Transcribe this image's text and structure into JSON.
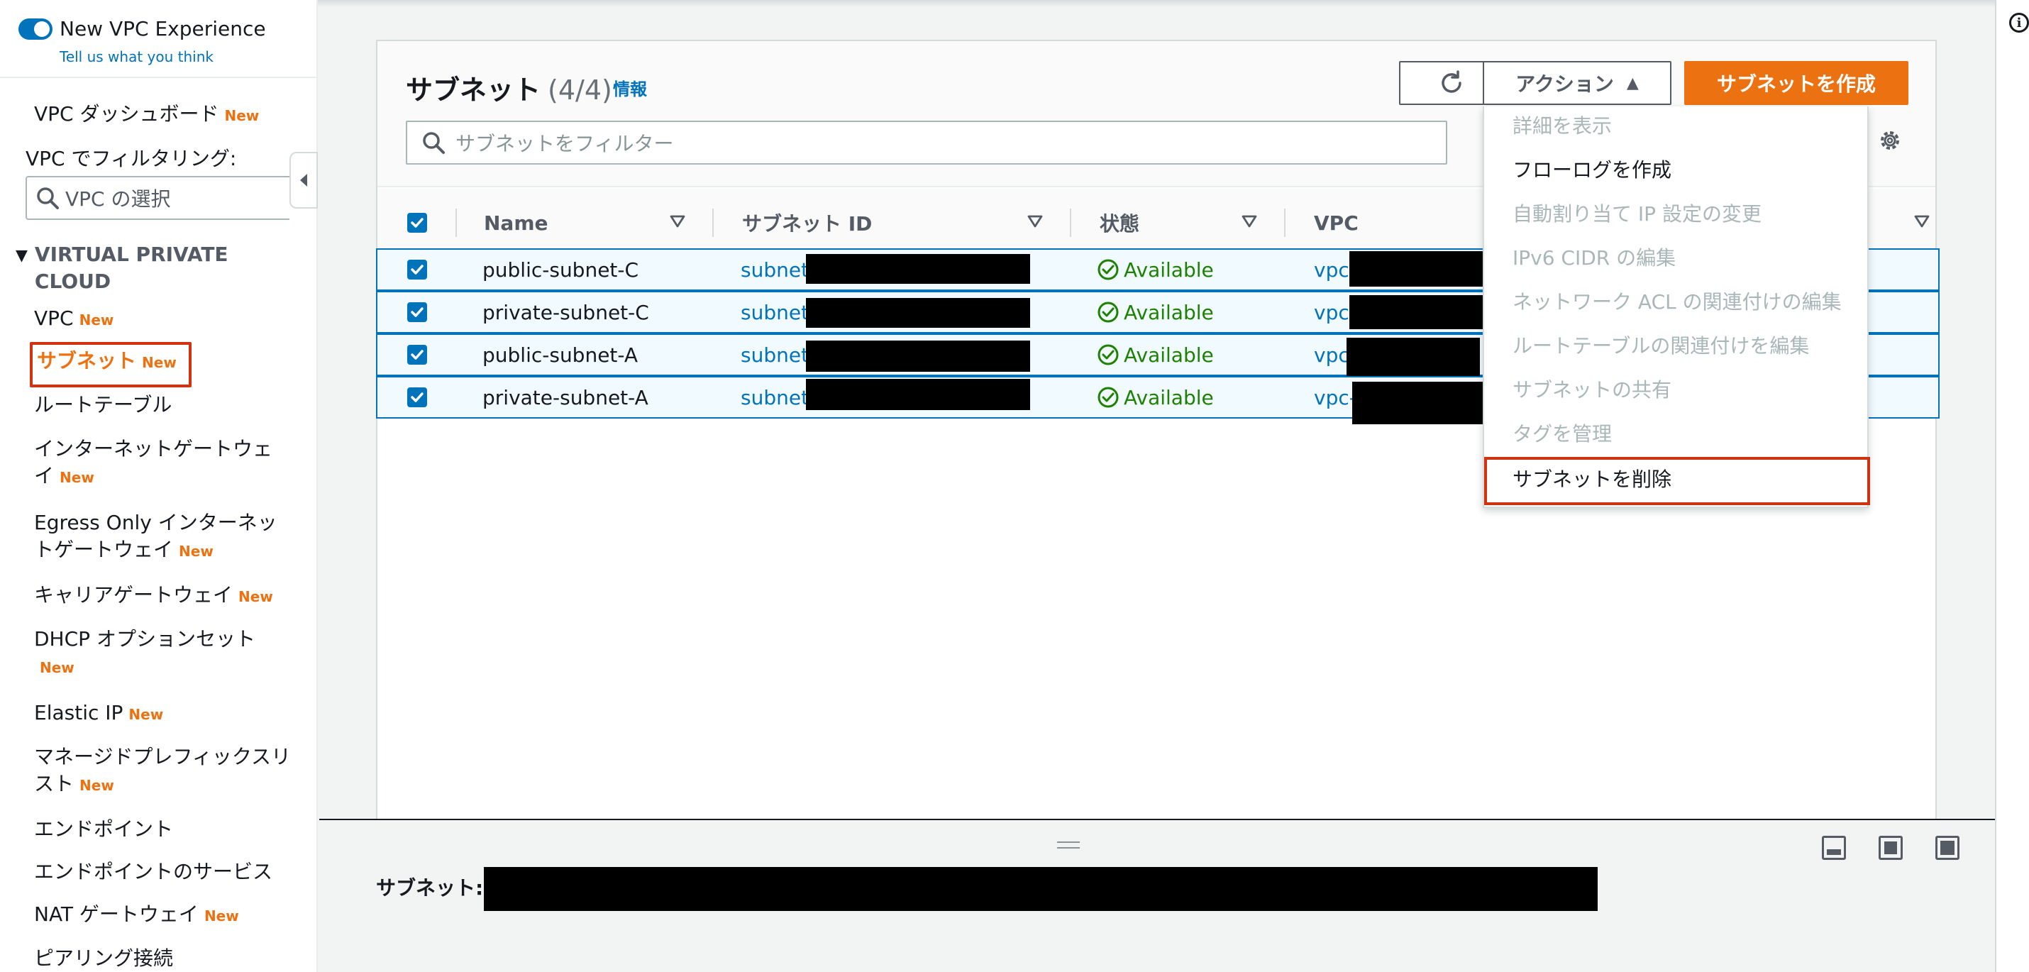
{
  "sidebar": {
    "toggle_label": "New VPC Experience",
    "feedback_link": "Tell us what you think",
    "dashboard": {
      "label": "VPC ダッシュボード",
      "badge": "New"
    },
    "filter_label": "VPC でフィルタリング:",
    "vpc_select_placeholder": "VPC の選択",
    "section_title": "VIRTUAL PRIVATE CLOUD",
    "items": [
      {
        "label": "VPC",
        "badge": "New"
      },
      {
        "label": "サブネット",
        "badge": "New",
        "active": true
      },
      {
        "label": "ルートテーブル",
        "badge": ""
      },
      {
        "label": "インターネットゲートウェイ",
        "badge": "New"
      },
      {
        "label": "Egress Only インターネットゲートウェイ",
        "badge": "New"
      },
      {
        "label": "キャリアゲートウェイ",
        "badge": "New"
      },
      {
        "label": "DHCP オプションセット",
        "badge": "New"
      },
      {
        "label": "Elastic IP",
        "badge": "New"
      },
      {
        "label": "マネージドプレフィックスリスト",
        "badge": "New"
      },
      {
        "label": "エンドポイント",
        "badge": ""
      },
      {
        "label": "エンドポイントのサービス",
        "badge": ""
      },
      {
        "label": "NAT ゲートウェイ",
        "badge": "New"
      },
      {
        "label": "ピアリング接続",
        "badge": ""
      }
    ]
  },
  "panel": {
    "title": "サブネット",
    "count": "(4/4)",
    "info_link": "情報",
    "actions_label": "アクション",
    "create_label": "サブネットを作成",
    "search_placeholder": "サブネットをフィルター"
  },
  "table": {
    "columns": [
      "Name",
      "サブネット ID",
      "状態",
      "VPC"
    ],
    "rows": [
      {
        "name": "public-subnet-C",
        "subnet_id": "subnet-",
        "status": "Available",
        "vpc": "vpc-",
        "checked": true
      },
      {
        "name": "private-subnet-C",
        "subnet_id": "subnet-",
        "status": "Available",
        "vpc": "vpc-",
        "checked": true
      },
      {
        "name": "public-subnet-A",
        "subnet_id": "subnet-",
        "status": "Available",
        "vpc": "vpc-",
        "checked": true
      },
      {
        "name": "private-subnet-A",
        "subnet_id": "subnet-",
        "status": "Available",
        "vpc": "vpc-",
        "checked": true
      }
    ]
  },
  "actions_menu": {
    "items": [
      {
        "label": "詳細を表示",
        "enabled": false
      },
      {
        "label": "フローログを作成",
        "enabled": true
      },
      {
        "label": "自動割り当て IP 設定の変更",
        "enabled": false
      },
      {
        "label": "IPv6 CIDR の編集",
        "enabled": false
      },
      {
        "label": "ネットワーク ACL の関連付けの編集",
        "enabled": false
      },
      {
        "label": "ルートテーブルの関連付けを編集",
        "enabled": false
      },
      {
        "label": "サブネットの共有",
        "enabled": false
      },
      {
        "label": "タグを管理",
        "enabled": false
      },
      {
        "label": "サブネットを削除",
        "enabled": true,
        "highlighted": true
      }
    ]
  },
  "split_panel": {
    "label": "サブネット:"
  },
  "colors": {
    "accent_blue": "#0073bb",
    "brand_orange": "#ec7211",
    "status_green": "#1d8102",
    "highlight_red": "#d13212"
  },
  "icons": [
    "refresh-icon",
    "caret-up-icon",
    "search-icon",
    "gear-icon",
    "sort-icon",
    "check-circle-icon",
    "info-icon",
    "collapse-left-icon"
  ]
}
